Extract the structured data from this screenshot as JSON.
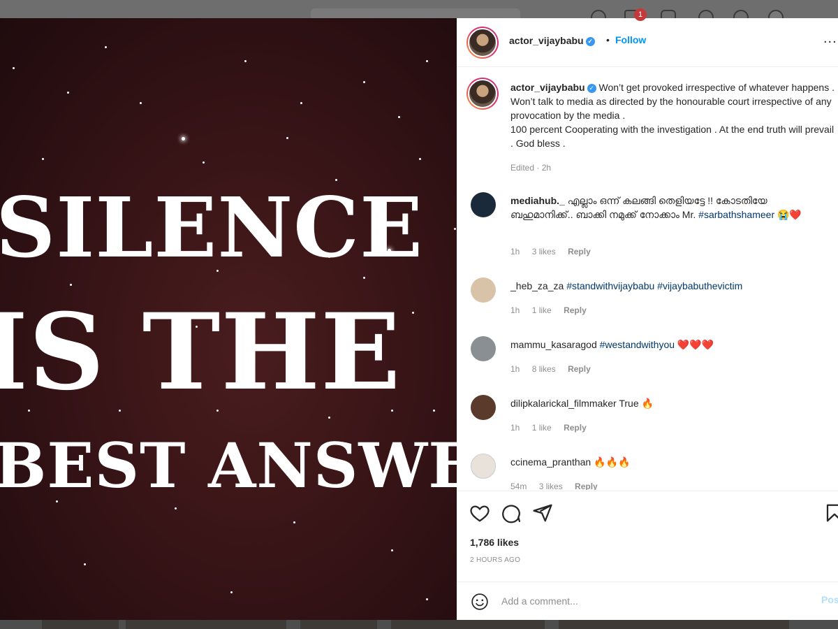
{
  "post": {
    "author": "actor_vijaybabu",
    "follow_label": "Follow",
    "separator": "•",
    "more_label": "...",
    "image_text": {
      "line1": "SILENCE",
      "line2": "IS THE",
      "line3": "BEST ANSWER"
    },
    "caption": "Won’t get provoked irrespective of whatever happens . Won’t talk to media as directed by the honourable court irrespective of any provocation by the media .\n100 percent Cooperating with the investigation . At the end truth will prevail . God bless .",
    "caption_meta": "Edited · 2h",
    "likes": "1,786 likes",
    "time": "2 HOURS AGO",
    "comment_placeholder": "Add a comment...",
    "post_label": "Post"
  },
  "comments": [
    {
      "user": "mediahub._",
      "text": "എല്ലാം ഒന്ന് കലങ്ങി തെളിയട്ടേ !! കോടതിയേ ബഹുമാനിക്ക്.. ബാക്കി നമുക്ക് നോക്കാം Mr. ",
      "hashtags": "#sarbathshameer",
      "emoji": "😭❤️",
      "time": "1h",
      "likes": "3 likes",
      "reply": "Reply"
    },
    {
      "user": "_heb_za_za",
      "text": "",
      "hashtags": "#standwithvijaybabu #vijaybabuthevictim",
      "emoji": "",
      "time": "1h",
      "likes": "1 like",
      "reply": "Reply"
    },
    {
      "user": "mammu_kasaragod",
      "text": "",
      "hashtags": "#westandwithyou",
      "emoji": "❤️❤️❤️",
      "time": "1h",
      "likes": "8 likes",
      "reply": "Reply"
    },
    {
      "user": "dilipkalarickal_filmmaker",
      "text": "True",
      "hashtags": "",
      "emoji": "🔥",
      "time": "1h",
      "likes": "1 like",
      "reply": "Reply"
    },
    {
      "user": "ccinema_pranthan",
      "text": "",
      "hashtags": "",
      "emoji": "🔥🔥🔥",
      "time": "54m",
      "likes": "3 likes",
      "reply": "Reply"
    }
  ],
  "colors": {
    "accent": "#0095f6",
    "hashtag": "#00376b",
    "muted": "#8e8e8e"
  },
  "icons": [
    "heart-icon",
    "comment-icon",
    "share-icon",
    "bookmark-icon",
    "emoji-icon",
    "verified-icon",
    "more-icon"
  ]
}
